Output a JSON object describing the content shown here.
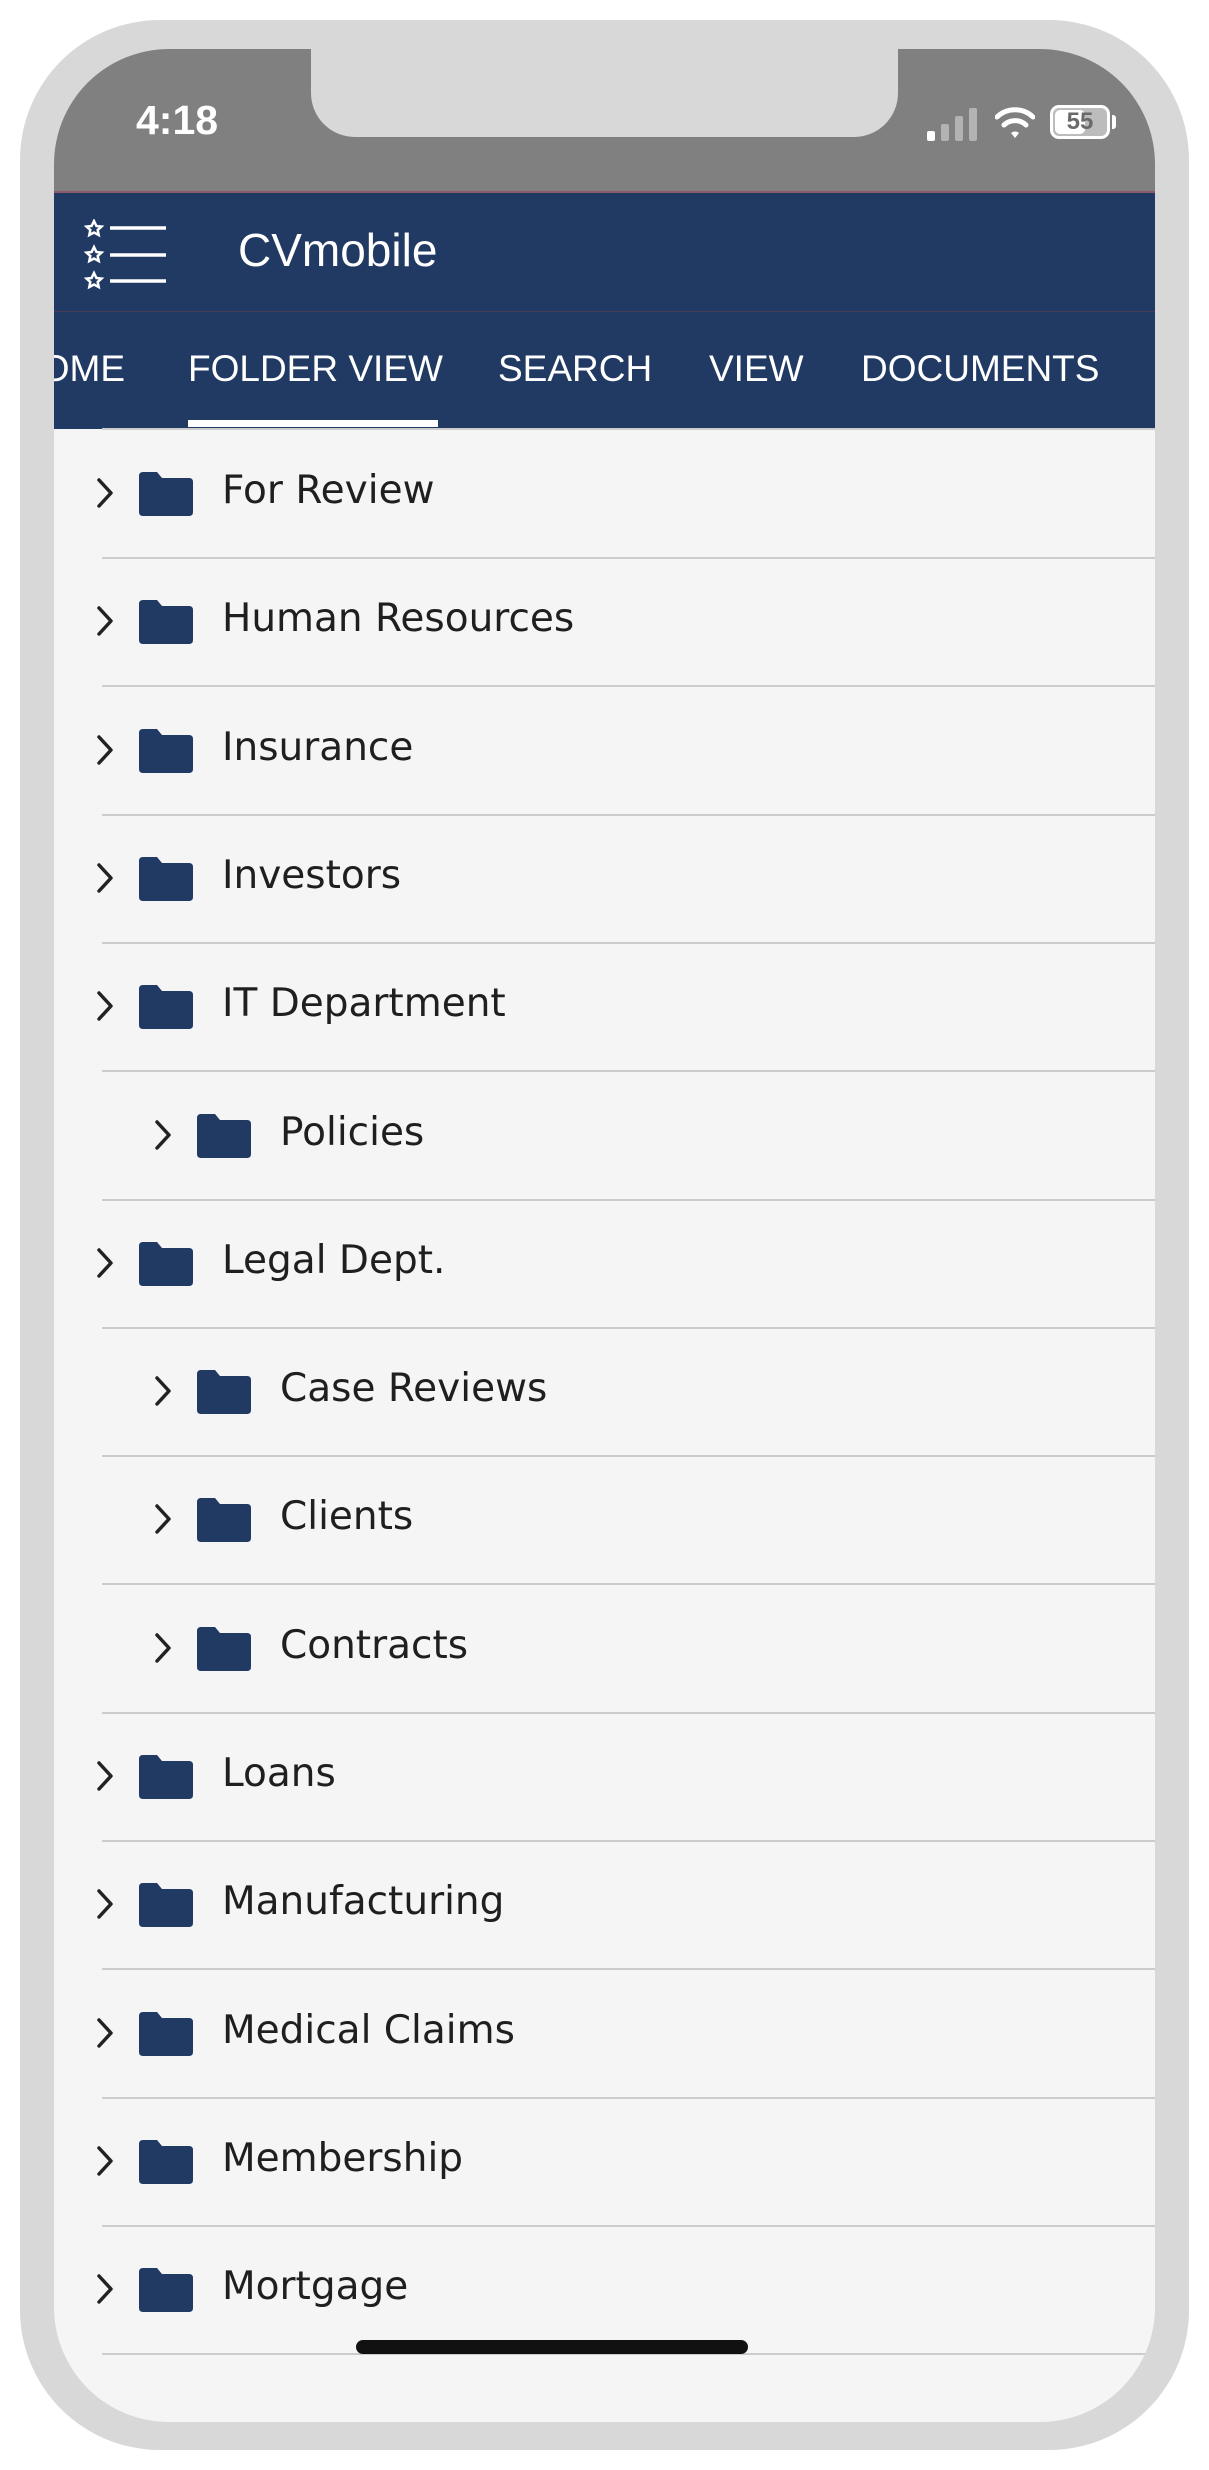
{
  "status": {
    "time": "4:18",
    "battery": "55"
  },
  "app": {
    "title": "CVmobile"
  },
  "tabs": [
    {
      "label": "HOME",
      "active": false
    },
    {
      "label": "FOLDER VIEW",
      "active": true
    },
    {
      "label": "SEARCH",
      "active": false
    },
    {
      "label": "VIEW",
      "active": false
    },
    {
      "label": "DOCUMENTS",
      "active": false
    }
  ],
  "folders": [
    {
      "label": "For Review",
      "level": 0
    },
    {
      "label": "Human Resources",
      "level": 0
    },
    {
      "label": "Insurance",
      "level": 0
    },
    {
      "label": "Investors",
      "level": 0
    },
    {
      "label": "IT Department",
      "level": 0
    },
    {
      "label": "Policies",
      "level": 1
    },
    {
      "label": "Legal Dept.",
      "level": 0
    },
    {
      "label": "Case Reviews",
      "level": 1
    },
    {
      "label": "Clients",
      "level": 1
    },
    {
      "label": "Contracts",
      "level": 1
    },
    {
      "label": "Loans",
      "level": 0
    },
    {
      "label": "Manufacturing",
      "level": 0
    },
    {
      "label": "Medical Claims",
      "level": 0
    },
    {
      "label": "Membership",
      "level": 0
    },
    {
      "label": "Mortgage",
      "level": 0
    }
  ],
  "colors": {
    "appbar": "#213a63",
    "folder": "#213a63",
    "statusbar": "#808080",
    "background": "#f5f5f5"
  }
}
